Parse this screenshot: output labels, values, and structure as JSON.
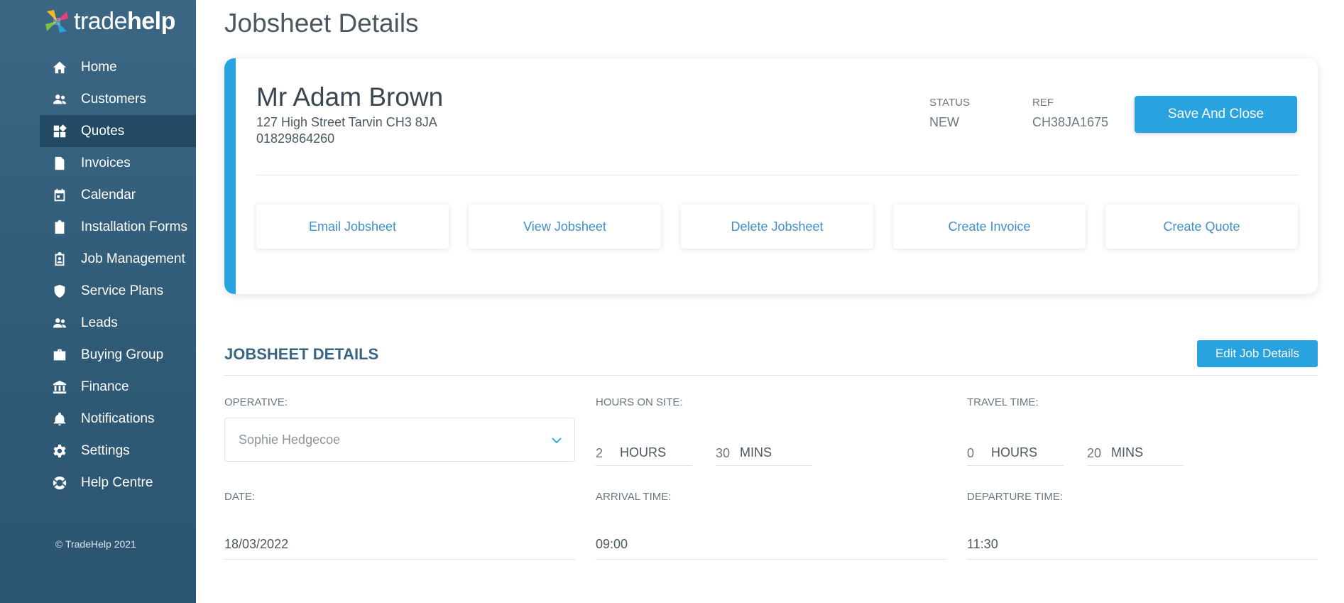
{
  "brand": {
    "name_light": "trade",
    "name_bold": "help"
  },
  "sidebar": {
    "items": [
      {
        "label": "Home",
        "icon": "home-icon"
      },
      {
        "label": "Customers",
        "icon": "people-icon"
      },
      {
        "label": "Quotes",
        "icon": "dashboard-icon",
        "active": true
      },
      {
        "label": "Invoices",
        "icon": "document-icon"
      },
      {
        "label": "Calendar",
        "icon": "calendar-icon"
      },
      {
        "label": "Installation Forms",
        "icon": "clipboard-icon"
      },
      {
        "label": "Job Management",
        "icon": "clipboard-person-icon"
      },
      {
        "label": "Service Plans",
        "icon": "shield-icon"
      },
      {
        "label": "Leads",
        "icon": "people-icon"
      },
      {
        "label": "Buying Group",
        "icon": "briefcase-icon"
      },
      {
        "label": "Finance",
        "icon": "bank-icon"
      },
      {
        "label": "Notifications",
        "icon": "bell-icon"
      },
      {
        "label": "Settings",
        "icon": "gear-icon"
      },
      {
        "label": "Help Centre",
        "icon": "lifebuoy-icon"
      }
    ],
    "copyright": "© TradeHelp 2021"
  },
  "page": {
    "title": "Jobsheet Details"
  },
  "customer": {
    "name": "Mr Adam Brown",
    "address": "127 High Street Tarvin CH3 8JA",
    "phone": "01829864260",
    "status_label": "STATUS",
    "status_value": "NEW",
    "ref_label": "REF",
    "ref_value": "CH38JA1675",
    "save_label": "Save And Close"
  },
  "actions": [
    "Email Jobsheet",
    "View Jobsheet",
    "Delete Jobsheet",
    "Create Invoice",
    "Create Quote"
  ],
  "details": {
    "section_title": "JOBSHEET DETAILS",
    "edit_label": "Edit Job Details",
    "operative_label": "OPERATIVE:",
    "operative_value": "Sophie Hedgecoe",
    "hours_on_site_label": "HOURS ON SITE:",
    "hours_on_site": {
      "hours": "2",
      "hours_unit": "HOURS",
      "mins": "30",
      "mins_unit": "MINS"
    },
    "travel_time_label": "TRAVEL TIME:",
    "travel_time": {
      "hours": "0",
      "hours_unit": "HOURS",
      "mins": "20",
      "mins_unit": "MINS"
    },
    "date_label": "DATE:",
    "date_value": "18/03/2022",
    "arrival_label": "ARRIVAL TIME:",
    "arrival_value": "09:00",
    "departure_label": "DEPARTURE TIME:",
    "departure_value": "11:30"
  },
  "colors": {
    "accent": "#29a3e0",
    "sidebar": "#356180",
    "section_title": "#3a6482"
  }
}
